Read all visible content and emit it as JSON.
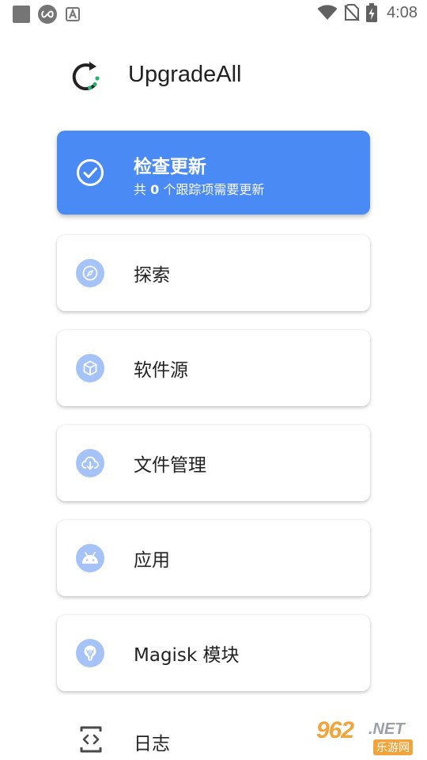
{
  "status_bar": {
    "time": "4:08",
    "icons": [
      "square-notification-icon",
      "infinity-app-icon",
      "a-font-icon",
      "wifi-icon",
      "no-sim-icon",
      "battery-charging-icon"
    ]
  },
  "header": {
    "app_name": "UpgradeAll",
    "logo_icon": "refresh-progress-icon"
  },
  "cards": {
    "check_updates": {
      "title": "检查更新",
      "subtitle_prefix": "共 ",
      "count": "0",
      "subtitle_suffix": " 个跟踪项需要更新",
      "icon": "check-circle-icon"
    },
    "discover": {
      "label": "探索",
      "icon": "compass-icon"
    },
    "sources": {
      "label": "软件源",
      "icon": "cube-icon"
    },
    "file_manager": {
      "label": "文件管理",
      "icon": "cloud-download-icon"
    },
    "apps": {
      "label": "应用",
      "icon": "android-icon"
    },
    "magisk": {
      "label": "Magisk 模块",
      "icon": "magisk-icon"
    }
  },
  "log": {
    "label": "日志",
    "icon": "code-phone-icon"
  },
  "watermark": {
    "number": "962",
    "suffix": ".NET",
    "cn": "乐游网"
  },
  "colors": {
    "primary": "#4a8af4",
    "icon_bg": "#a5c3f7",
    "accent_green": "#1fb36b",
    "watermark_orange": "#f2a33a"
  }
}
